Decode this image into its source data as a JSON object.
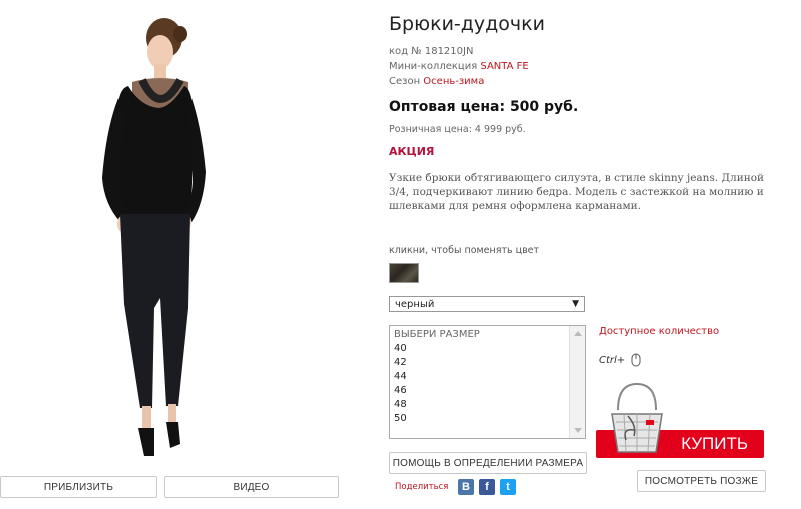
{
  "product": {
    "title": "Брюки-дудочки",
    "code_label": "код №",
    "code": "181210JN",
    "collection_label": "Мини-коллекция",
    "collection": "SANTA FE",
    "season_label": "Сезон",
    "season": "Осень-зима",
    "wholesale": "Оптовая цена: 500 руб.",
    "retail": "Розничная цена: 4 999 руб.",
    "promo": "АКЦИЯ",
    "description": "Узкие брюки обтягивающего силуэта, в стиле skinny jeans. Длиной 3/4, подчеркивают линию бедра.  Модель с застежкой на молнию и шлевками для ремня оформлена карманами."
  },
  "photo_buttons": {
    "zoom": "ПРИБЛИЗИТЬ",
    "video": "ВИДЕО"
  },
  "color": {
    "hint": "кликни, чтобы поменять цвет",
    "selected": "черный"
  },
  "sizes": {
    "placeholder": "ВЫБЕРИ РАЗМЕР",
    "options": [
      "40",
      "42",
      "44",
      "46",
      "48",
      "50"
    ]
  },
  "actions": {
    "available": "Доступное количество",
    "ctrl_hint": "Ctrl+",
    "size_help": "ПОМОЩЬ В ОПРЕДЕЛЕНИИ РАЗМЕРА",
    "buy": "КУПИТЬ",
    "later": "ПОСМОТРЕТЬ ПОЗЖЕ",
    "share": "Поделиться"
  },
  "social": [
    {
      "name": "vk-icon",
      "glyph": "B",
      "color": "#4a76a8"
    },
    {
      "name": "facebook-icon",
      "glyph": "f",
      "color": "#3b5998"
    },
    {
      "name": "twitter-icon",
      "glyph": "t",
      "color": "#1da1f2"
    }
  ]
}
